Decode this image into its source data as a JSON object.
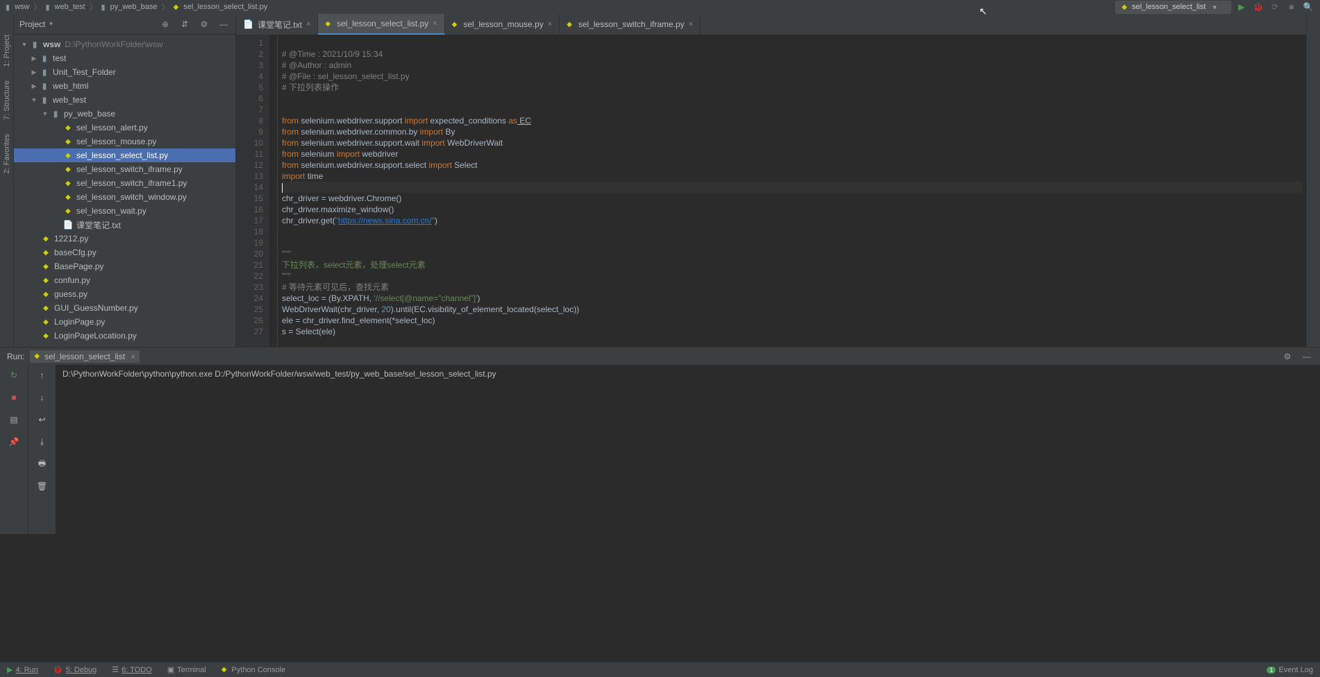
{
  "breadcrumb": [
    "wsw",
    "web_test",
    "py_web_base",
    "sel_lesson_select_list.py"
  ],
  "run_config": "sel_lesson_select_list",
  "sidebar": {
    "title": "Project",
    "vertical_tabs": [
      "1: Project",
      "7: Structure",
      "2: Favorites"
    ]
  },
  "tree": {
    "root": "wsw",
    "root_path": "D:\\PythonWorkFolder\\wsw",
    "folders": {
      "test": "test",
      "unit_test": "Unit_Test_Folder",
      "web_html": "web_html",
      "web_test": "web_test",
      "py_web_base": "py_web_base"
    },
    "py_files": [
      "sel_lesson_alert.py",
      "sel_lesson_mouse.py",
      "sel_lesson_select_list.py",
      "sel_lesson_switch_iframe.py",
      "sel_lesson_switch_iframe1.py",
      "sel_lesson_switch_window.py",
      "sel_lesson_wait.py"
    ],
    "txt": "课堂笔记.txt",
    "root_files": [
      "12212.py",
      "baseCfg.py",
      "BasePage.py",
      "confun.py",
      "guess.py",
      "GUI_GuessNumber.py",
      "LoginPage.py",
      "LoginPageLocation.py"
    ]
  },
  "tabs": [
    {
      "label": "课堂笔记.txt",
      "icon": "txt"
    },
    {
      "label": "sel_lesson_select_list.py",
      "icon": "py",
      "active": true
    },
    {
      "label": "sel_lesson_mouse.py",
      "icon": "py"
    },
    {
      "label": "sel_lesson_switch_iframe.py",
      "icon": "py"
    }
  ],
  "code": {
    "l1": "# @Time : 2021/10/9 15:34",
    "l2": "# @Author : admin",
    "l3": "# @File : sel_lesson_select_list.py",
    "l4": "# 下拉列表操作",
    "l7a": "from",
    "l7b": " selenium.webdriver.support ",
    "l7c": "import",
    "l7d": " expected_conditions ",
    "l7e": "as",
    "l7f": " EC",
    "l8a": "from",
    "l8b": " selenium.webdriver.common.by ",
    "l8c": "import",
    "l8d": " By",
    "l9a": "from",
    "l9b": " selenium.webdriver.support.wait ",
    "l9c": "import",
    "l9d": " WebDriverWait",
    "l10a": "from",
    "l10b": " selenium ",
    "l10c": "import",
    "l10d": " webdriver",
    "l11a": "from",
    "l11b": " selenium.webdriver.support.select ",
    "l11c": "import",
    "l11d": " Select",
    "l12a": "import",
    "l12b": " time",
    "l14": "chr_driver = webdriver.Chrome()",
    "l15": "chr_driver.maximize_window()",
    "l16a": "chr_driver.get(",
    "l16b": "\"",
    "l16url": "https://news.sina.com.cn/",
    "l16c": "\"",
    "l16d": ")",
    "l19": "\"\"\"",
    "l20": "下拉列表，select元素，处理select元素",
    "l21": "\"\"\"",
    "l22": "# 等待元素可见后，查找元素",
    "l23a": "select_loc = (By.XPATH, ",
    "l23b": "'//select[@name=\"channel\"]'",
    "l23c": ")",
    "l24a": "WebDriverWait(chr_driver, ",
    "l24n": "20",
    "l24b": ").until(EC.visibility_of_element_located(select_loc))",
    "l25": "ele = chr_driver.find_element(*select_loc)",
    "l26": "s = Select(ele)"
  },
  "line_numbers": [
    "1",
    "2",
    "3",
    "4",
    "5",
    "6",
    "7",
    "8",
    "9",
    "10",
    "11",
    "12",
    "13",
    "14",
    "15",
    "16",
    "17",
    "18",
    "19",
    "20",
    "21",
    "22",
    "23",
    "24",
    "25",
    "26",
    "27"
  ],
  "run": {
    "label": "Run:",
    "tab": "sel_lesson_select_list",
    "output": "D:\\PythonWorkFolder\\python\\python.exe D:/PythonWorkFolder/wsw/web_test/py_web_base/sel_lesson_select_list.py"
  },
  "status": {
    "run": "4: Run",
    "debug": "5: Debug",
    "todo": "6: TODO",
    "terminal": "Terminal",
    "pyconsole": "Python Console",
    "eventlog": "Event Log",
    "badge": "1"
  }
}
